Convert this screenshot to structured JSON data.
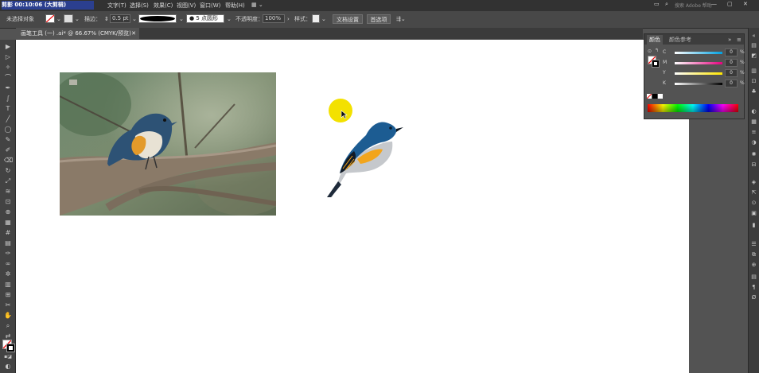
{
  "menubar": {
    "app_text": "剪影 00:10:06 (大剪辑)",
    "menus": [
      "文字(T)",
      "选择(S)",
      "效果(C)",
      "视图(V)",
      "窗口(W)",
      "帮助(H)"
    ],
    "search_placeholder": "搜索 Adobe 帮助"
  },
  "control": {
    "selection_state": "未选择对象",
    "stroke_label": "描边：",
    "stroke_value": "0.5 pt",
    "brush_label": "5 点圆形",
    "opacity_label": "不透明度：",
    "opacity_value": "100%",
    "style_label": "样式：",
    "doc_setup": "文档设置",
    "prefs": "首选项"
  },
  "document": {
    "tab_title": "画笔工具 (一) .ai* @ 66.67% (CMYK/预览)"
  },
  "panel": {
    "tab_color": "颜色",
    "tab_color_guide": "颜色参考",
    "sliders": [
      {
        "label": "C",
        "value": "0",
        "unit": "%"
      },
      {
        "label": "M",
        "value": "0",
        "unit": "%"
      },
      {
        "label": "Y",
        "value": "0",
        "unit": "%"
      },
      {
        "label": "K",
        "value": "0",
        "unit": "%"
      }
    ]
  },
  "colors": {
    "highlight": "#f3e100",
    "bird_blue": "#1c5c92",
    "bird_orange": "#f2a51c",
    "bird_gray": "#c5c8cc"
  }
}
